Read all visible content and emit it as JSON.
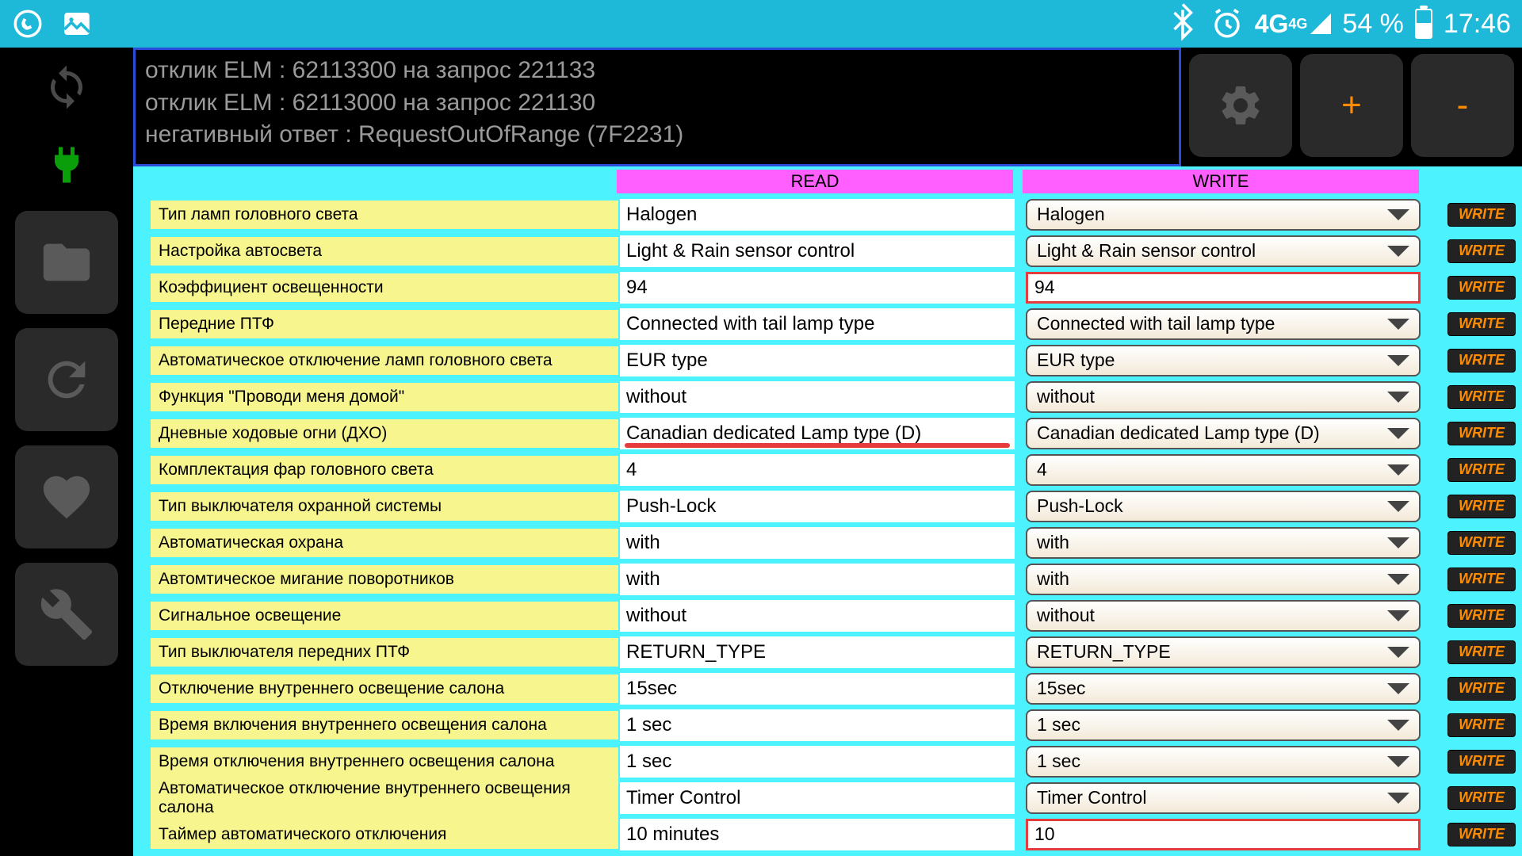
{
  "status": {
    "battery": "54 %",
    "time": "17:46",
    "network": "4G",
    "network_sup": "4G"
  },
  "log": {
    "line1": "отклик ELM : 62113300 на запрос 221133",
    "line2": "отклик ELM : 62113000 на запрос 221130",
    "line3": "негативный ответ : RequestOutOfRange (7F2231)"
  },
  "top_buttons": {
    "plus": "+",
    "minus": "-"
  },
  "headers": {
    "read": "READ",
    "write": "WRITE"
  },
  "write_btn": "WRITE",
  "rows": [
    {
      "label": "Тип ламп головного света",
      "read": "Halogen",
      "write": "Halogen",
      "type": "dd"
    },
    {
      "label": "Настройка автосвета",
      "read": "Light & Rain sensor control",
      "write": "Light & Rain sensor control",
      "type": "dd"
    },
    {
      "label": "Коэффициент освещенности",
      "read": "94",
      "write": "94",
      "type": "input"
    },
    {
      "label": "Передние ПТФ",
      "read": "Connected with tail lamp type",
      "write": "Connected with tail lamp type",
      "type": "dd"
    },
    {
      "label": "Автоматическое отключение ламп головного света",
      "read": "EUR type",
      "write": "EUR type",
      "type": "dd"
    },
    {
      "label": "Функция \"Проводи меня домой\"",
      "read": "without",
      "write": "without",
      "type": "dd"
    },
    {
      "label": "Дневные ходовые огни (ДХО)",
      "read": "Canadian dedicated Lamp type (D)",
      "write": "Canadian dedicated Lamp type (D)",
      "type": "dd",
      "highlighted": true
    },
    {
      "label": "Комплектация фар головного света",
      "read": "4",
      "write": "4",
      "type": "dd"
    },
    {
      "label": "Тип выключателя охранной системы",
      "read": "Push-Lock",
      "write": "Push-Lock",
      "type": "dd"
    },
    {
      "label": "Автоматическая охрана",
      "read": "with",
      "write": "with",
      "type": "dd"
    },
    {
      "label": "Автомтическое мигание поворотников",
      "read": "with",
      "write": "with",
      "type": "dd"
    },
    {
      "label": "Сигнальное освещение",
      "read": "without",
      "write": "without",
      "type": "dd"
    },
    {
      "label": "Тип выключателя передних ПТФ",
      "read": "RETURN_TYPE",
      "write": "RETURN_TYPE",
      "type": "dd"
    },
    {
      "label": "Отключение внутреннего освещение салона",
      "read": "15sec",
      "write": "15sec",
      "type": "dd"
    },
    {
      "label": "Время включения внутреннего освещения салона",
      "read": "1 sec",
      "write": "1 sec",
      "type": "dd"
    },
    {
      "label": "Время отключения внутреннего освещения салона",
      "read": "1 sec",
      "write": "1 sec",
      "type": "dd"
    },
    {
      "label": "Автоматическое отключение внутреннего освещения салона",
      "read": "Timer Control",
      "write": "Timer Control",
      "type": "dd"
    },
    {
      "label": "Таймер автоматического отключения",
      "read": "10 minutes",
      "write": "10",
      "type": "input"
    }
  ]
}
